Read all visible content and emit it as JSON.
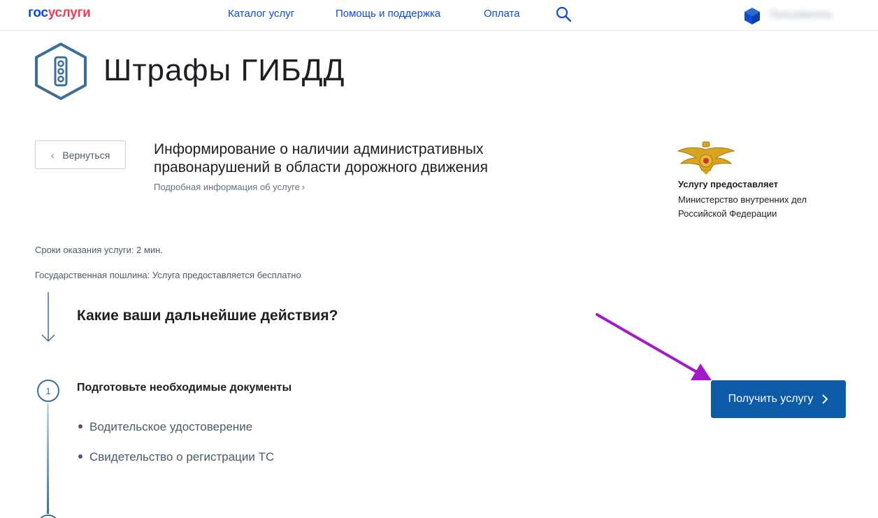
{
  "header": {
    "logo_part1": "гос",
    "logo_part2": "услуги",
    "nav": [
      "Каталог услуг",
      "Помощь и поддержка",
      "Оплата"
    ],
    "user_name": "Пользователь"
  },
  "page": {
    "title": "Штрафы ГИБДД",
    "back_label": "Вернуться",
    "service_heading": "Информирование о наличии административных правонарушений в области дорожного движения",
    "details_link": "Подробная информация об услуге"
  },
  "provider": {
    "label": "Услугу предоставляет",
    "name": "Министерство внутренних дел Российской Федерации"
  },
  "info": {
    "terms": "Сроки оказания услуги: 2 мин.",
    "fee": "Государственная пошлина: Услуга предоставляется бесплатно"
  },
  "steps": {
    "heading": "Какие ваши дальнейшие действия?",
    "step1_number": "1",
    "step1_title": "Подготовьте необходимые документы",
    "documents": [
      "Водительское удостоверение",
      "Свидетельство о регистрации ТС"
    ]
  },
  "cta": {
    "label": "Получить услугу"
  },
  "colors": {
    "brand_blue": "#0d4cd3",
    "brand_red": "#ee3f58",
    "button_blue": "#0d5aa7",
    "annotation_purple": "#a31bc6"
  }
}
